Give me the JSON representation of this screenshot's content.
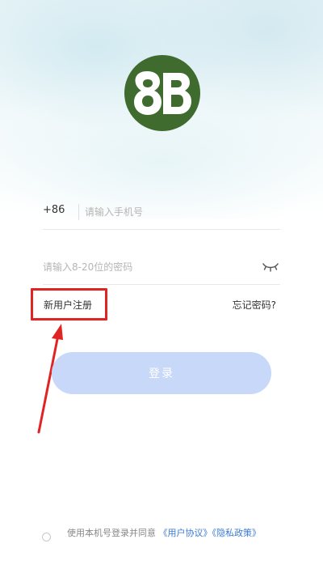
{
  "logo": {
    "text": "8B",
    "icon": "8b-logo-icon",
    "background": "#3f6b2f"
  },
  "phone": {
    "country_code": "+86",
    "placeholder": "请输入手机号",
    "value": ""
  },
  "password": {
    "placeholder": "请输入8-20位的密码",
    "value": "",
    "toggle_icon": "eye-closed-icon"
  },
  "links": {
    "register": "新用户注册",
    "forgot_password": "忘记密码?"
  },
  "login_button": {
    "label": "登录",
    "color": "#c8d8f8"
  },
  "agreement": {
    "prefix": "使用本机号登录并同意",
    "user_agreement": "《用户协议》",
    "privacy_policy": "《隐私政策》"
  },
  "annotation": {
    "color": "#e02424"
  }
}
